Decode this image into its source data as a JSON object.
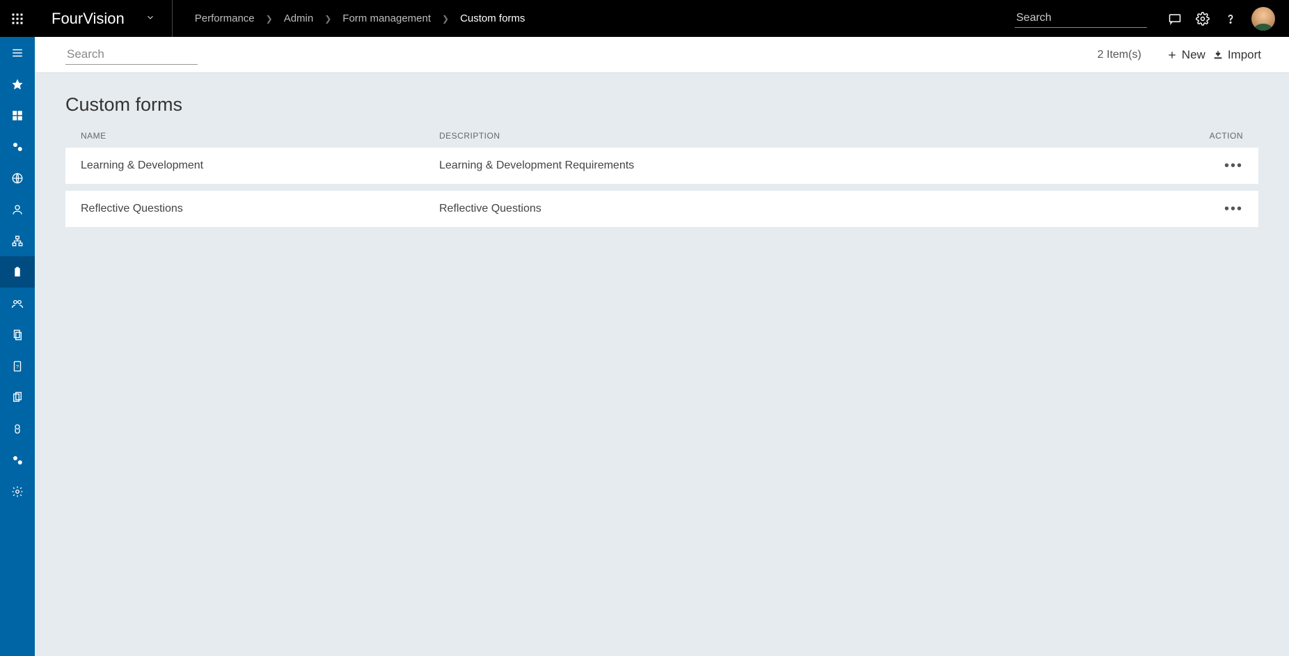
{
  "header": {
    "brand": "FourVision",
    "breadcrumb": [
      "Performance",
      "Admin",
      "Form management",
      "Custom forms"
    ],
    "searchPlaceholder": "Search"
  },
  "subbar": {
    "searchPlaceholder": "Search",
    "itemCount": "2 Item(s)",
    "newLabel": "New",
    "importLabel": "Import"
  },
  "page": {
    "title": "Custom forms",
    "columns": {
      "name": "NAME",
      "description": "DESCRIPTION",
      "action": "ACTION"
    },
    "rows": [
      {
        "name": "Learning & Development",
        "description": "Learning & Development Requirements"
      },
      {
        "name": "Reflective Questions",
        "description": "Reflective Questions"
      }
    ]
  },
  "sidebar": {
    "items": [
      "menu",
      "favorites",
      "dashboard",
      "settings-gear",
      "globe",
      "person",
      "hierarchy",
      "clipboard",
      "team",
      "documents",
      "help-doc",
      "copy",
      "security",
      "admin-gear",
      "system-gear"
    ]
  }
}
